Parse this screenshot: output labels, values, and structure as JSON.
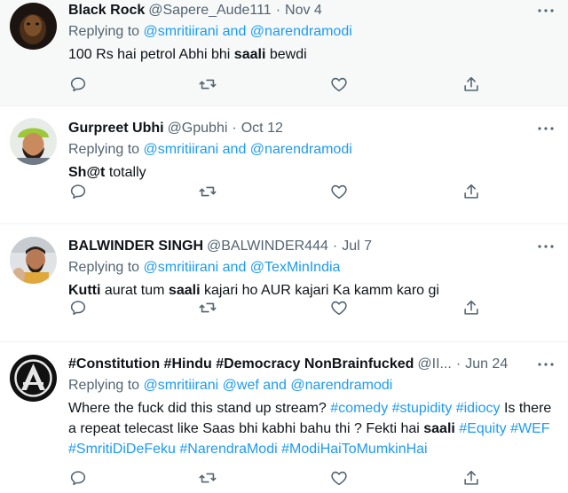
{
  "colors": {
    "accent": "#1d9bf0",
    "secondary_text": "#536471",
    "highlight_bg": "#f7f9f9"
  },
  "tweets": [
    {
      "name": "Black Rock",
      "handle": "@Sapere_Aude111",
      "date": "Nov 4",
      "replying_prefix": "Replying to",
      "reply_to_1": "@smritiirani",
      "reply_sep": "and",
      "reply_to_2": "@narendramodi",
      "text_a": "100 Rs hai petrol Abhi bhi ",
      "text_bold": "saali",
      "text_b": " bewdi"
    },
    {
      "name": "Gurpreet Ubhi",
      "handle": "@Gpubhi",
      "date": "Oct 12",
      "replying_prefix": "Replying to",
      "reply_to_1": "@smritiirani",
      "reply_sep": "and",
      "reply_to_2": "@narendramodi",
      "text_bold": "Sh@t",
      "text_b": " totally"
    },
    {
      "name": "BALWINDER SINGH",
      "handle": "@BALWINDER444",
      "date": "Jul 7",
      "replying_prefix": "Replying to",
      "reply_to_1": "@smritiirani",
      "reply_sep": "and",
      "reply_to_2": "@TexMinIndia",
      "text_bold_1": "Kutti",
      "text_a": " aurat tum ",
      "text_bold_2": "saali",
      "text_b": " kajari ho AUR kajari Ka kamm karo gi"
    },
    {
      "name": "#Constitution #Hindu #Democracy NonBrainfucked",
      "handle": "@II...",
      "date": "Jun 24",
      "replying_prefix": "Replying to",
      "reply_to_1": "@smritiirani",
      "reply_to_2": "@wef",
      "reply_sep": "and",
      "reply_to_3": "@narendramodi",
      "text_a": "Where the fuck did this stand up stream? ",
      "tag_1": "#comedy",
      "tag_2": "#stupidity",
      "tag_3": "#idiocy",
      "text_b": " Is there a repeat telecast like Saas bhi kabhi bahu thi ? Fekti hai ",
      "text_bold": "saali",
      "tag_4": "#Equity",
      "tag_5": "#WEF",
      "tag_6": "#SmritiDiDeFeku",
      "tag_7": "#NarendraModi",
      "tag_8": "#ModiHaiToMumkinHai"
    }
  ],
  "icons": {
    "reply": "reply-icon",
    "retweet": "retweet-icon",
    "like": "heart-icon",
    "share": "share-icon",
    "more": "more-icon"
  }
}
